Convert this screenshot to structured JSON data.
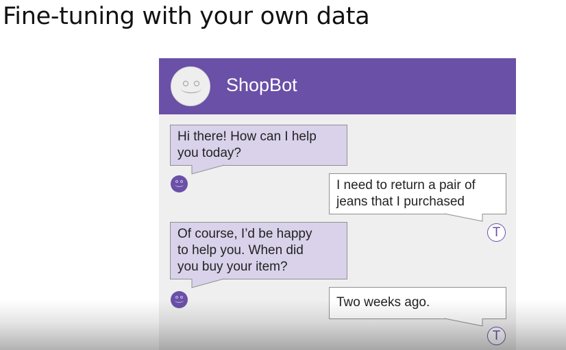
{
  "slide": {
    "title": "Fine-tuning with your own data"
  },
  "chat": {
    "bot_name": "ShopBot",
    "header_color": "#6a50a7",
    "bot_bubble_color": "#d9d2ea",
    "user_avatar_letter": "T",
    "messages": [
      {
        "sender": "bot",
        "text": "Hi there! How can I help\nyou today?"
      },
      {
        "sender": "user",
        "text": "I need to return a pair of\njeans that I purchased"
      },
      {
        "sender": "bot",
        "text": "Of course, I’d be happy\nto help you. When did\nyou buy your item?"
      },
      {
        "sender": "user",
        "text": "Two weeks ago."
      }
    ],
    "icons": {
      "header_avatar": "smiley-face-icon",
      "bot_avatar": "smiley-face-icon",
      "user_avatar": "letter-avatar-icon"
    }
  }
}
